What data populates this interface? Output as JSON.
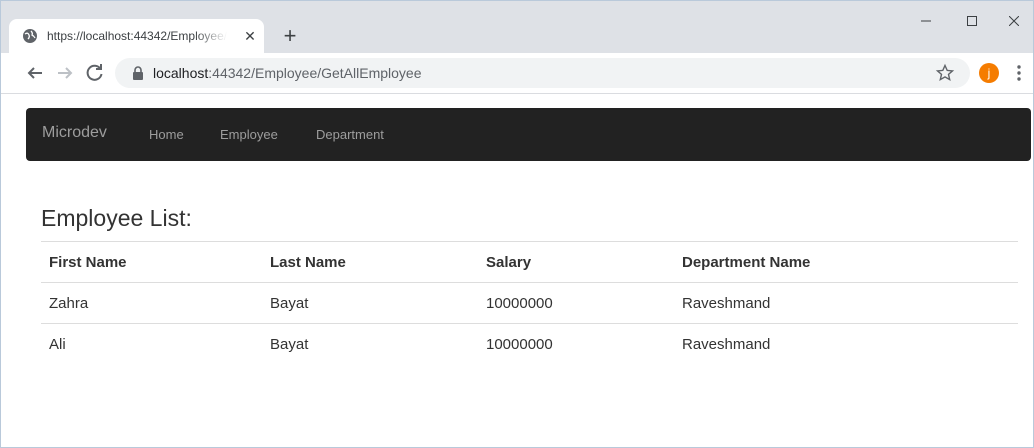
{
  "browser": {
    "tab": {
      "title": "https://localhost:44342/Employee/GetAllEmployee",
      "favicon": "globe-icon",
      "close_icon": "close-icon"
    },
    "new_tab_icon": "plus-icon",
    "window_controls": [
      "minimize-icon",
      "maximize-icon",
      "close-icon"
    ],
    "toolbar": {
      "back_icon": "arrow-left-icon",
      "forward_icon": "arrow-right-icon",
      "reload_icon": "reload-icon",
      "url_host": "localhost",
      "url_path": ":44342/Employee/GetAllEmployee",
      "bookmark_icon": "star-icon",
      "profile_initial": "j",
      "profile_color": "#f57c00",
      "menu_icon": "more-vertical-icon"
    }
  },
  "navbar": {
    "brand": "Microdev",
    "links": [
      "Home",
      "Employee",
      "Department"
    ],
    "background": "#222222"
  },
  "page": {
    "title": "Employee List:",
    "table": {
      "columns": [
        "First Name",
        "Last Name",
        "Salary",
        "Department Name"
      ],
      "rows": [
        [
          "Zahra",
          "Bayat",
          "10000000",
          "Raveshmand"
        ],
        [
          "Ali",
          "Bayat",
          "10000000",
          "Raveshmand"
        ]
      ]
    }
  }
}
